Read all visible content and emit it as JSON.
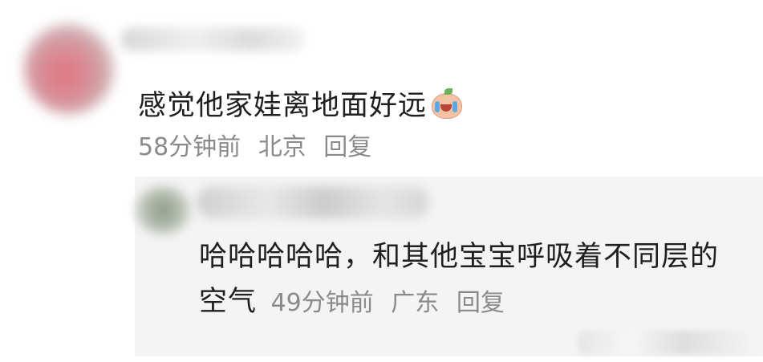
{
  "comment": {
    "text": "感觉他家娃离地面好远",
    "emoji_icon": "crying-laughing-peach-icon",
    "time": "58分钟前",
    "location": "北京",
    "reply_label": "回复"
  },
  "reply": {
    "text": "哈哈哈哈哈，和其他宝宝呼吸着不同层的空气",
    "time": "49分钟前",
    "location": "广东",
    "reply_label": "回复"
  },
  "colors": {
    "text_primary": "#1f1f1f",
    "text_meta": "#8a8a8a",
    "reply_background": "#f4f4f4"
  }
}
